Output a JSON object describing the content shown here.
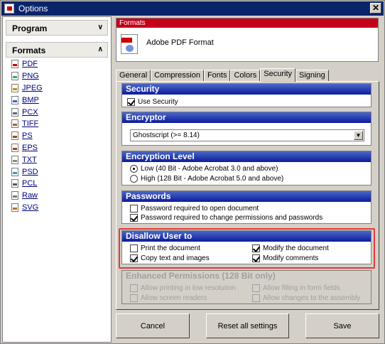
{
  "window": {
    "title": "Options",
    "close_label": "✕"
  },
  "sidebar": {
    "program_label": "Program",
    "formats_label": "Formats",
    "items": [
      {
        "label": "PDF",
        "icon": "pdf-file-icon"
      },
      {
        "label": "PNG",
        "icon": "png-file-icon"
      },
      {
        "label": "JPEG",
        "icon": "jpeg-file-icon"
      },
      {
        "label": "BMP",
        "icon": "bmp-file-icon"
      },
      {
        "label": "PCX",
        "icon": "pcx-file-icon"
      },
      {
        "label": "TIFF",
        "icon": "tiff-file-icon"
      },
      {
        "label": "PS",
        "icon": "ps-file-icon"
      },
      {
        "label": "EPS",
        "icon": "eps-file-icon"
      },
      {
        "label": "TXT",
        "icon": "txt-file-icon"
      },
      {
        "label": "PSD",
        "icon": "psd-file-icon"
      },
      {
        "label": "PCL",
        "icon": "pcl-file-icon"
      },
      {
        "label": "Raw",
        "icon": "raw-file-icon"
      },
      {
        "label": "SVG",
        "icon": "svg-file-icon"
      }
    ]
  },
  "formats_panel": {
    "header": "Formats",
    "format_name": "Adobe PDF Format",
    "icon": "pdf-file-icon"
  },
  "tabs": [
    "General",
    "Compression",
    "Fonts",
    "Colors",
    "Security",
    "Signing"
  ],
  "active_tab": "Security",
  "security": {
    "header": "Security",
    "use_security": {
      "label": "Use Security",
      "checked": true
    }
  },
  "encryptor": {
    "header": "Encryptor",
    "selected": "Ghostscript (>= 8.14)"
  },
  "encryption_level": {
    "header": "Encryption Level",
    "options": [
      {
        "label": "Low (40 Bit - Adobe Acrobat 3.0 and above)",
        "selected": true
      },
      {
        "label": "High (128 Bit - Adobe Acrobat 5.0 and above)",
        "selected": false
      }
    ]
  },
  "passwords": {
    "header": "Passwords",
    "open": {
      "label": "Password required to open document",
      "checked": false
    },
    "change": {
      "label": "Password required to change permissions and passwords",
      "checked": true
    }
  },
  "disallow": {
    "header": "Disallow User to",
    "print": {
      "label": "Print the document",
      "checked": false
    },
    "copy": {
      "label": "Copy text and images",
      "checked": true
    },
    "modify": {
      "label": "Modify the document",
      "checked": true
    },
    "comments": {
      "label": "Modify comments",
      "checked": true
    }
  },
  "enhanced": {
    "header": "Enhanced Permissions (128 Bit only)",
    "low_res": "Allow printing in low resolution",
    "screen_readers": "Allow screen readers",
    "form_fields": "Allow filling in form fields",
    "assembly": "Allow changes to the assembly"
  },
  "buttons": {
    "cancel": "Cancel",
    "reset": "Reset all settings",
    "save": "Save"
  },
  "colors": {
    "title_bar": "#0a246a",
    "group_header": "#0c1c9c",
    "formats_header": "#c4001a",
    "highlight": "#e03b3b"
  }
}
